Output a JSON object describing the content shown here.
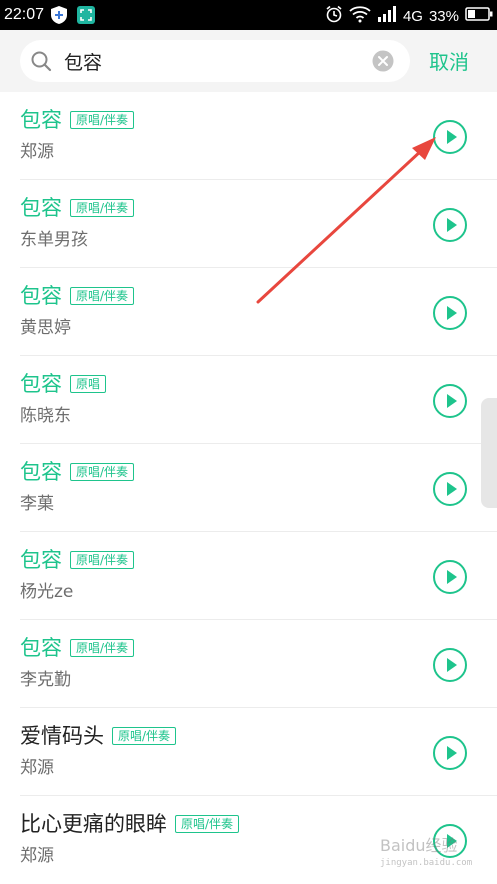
{
  "status_bar": {
    "time": "22:07",
    "network": "4G",
    "battery": "33%"
  },
  "search": {
    "query": "包容",
    "cancel_label": "取消"
  },
  "results": [
    {
      "title": "包容",
      "tag": "原唱/伴奏",
      "artist": "郑源",
      "highlight": true
    },
    {
      "title": "包容",
      "tag": "原唱/伴奏",
      "artist": "东单男孩",
      "highlight": true
    },
    {
      "title": "包容",
      "tag": "原唱/伴奏",
      "artist": "黄思婷",
      "highlight": true
    },
    {
      "title": "包容",
      "tag": "原唱",
      "artist": "陈晓东",
      "highlight": true
    },
    {
      "title": "包容",
      "tag": "原唱/伴奏",
      "artist": "李菓",
      "highlight": true
    },
    {
      "title": "包容",
      "tag": "原唱/伴奏",
      "artist": "杨光ze",
      "highlight": true
    },
    {
      "title": "包容",
      "tag": "原唱/伴奏",
      "artist": "李克勤",
      "highlight": true
    },
    {
      "title": "爱情码头",
      "tag": "原唱/伴奏",
      "artist": "郑源",
      "highlight": false
    },
    {
      "title": "比心更痛的眼眸",
      "tag": "原唱/伴奏",
      "artist": "郑源",
      "highlight": false
    }
  ],
  "watermark": {
    "text": "Baidu经验",
    "url": "jingyan.baidu.com"
  },
  "colors": {
    "accent": "#1ec48c",
    "arrow": "#e8473e",
    "status_bar": "#000000"
  }
}
